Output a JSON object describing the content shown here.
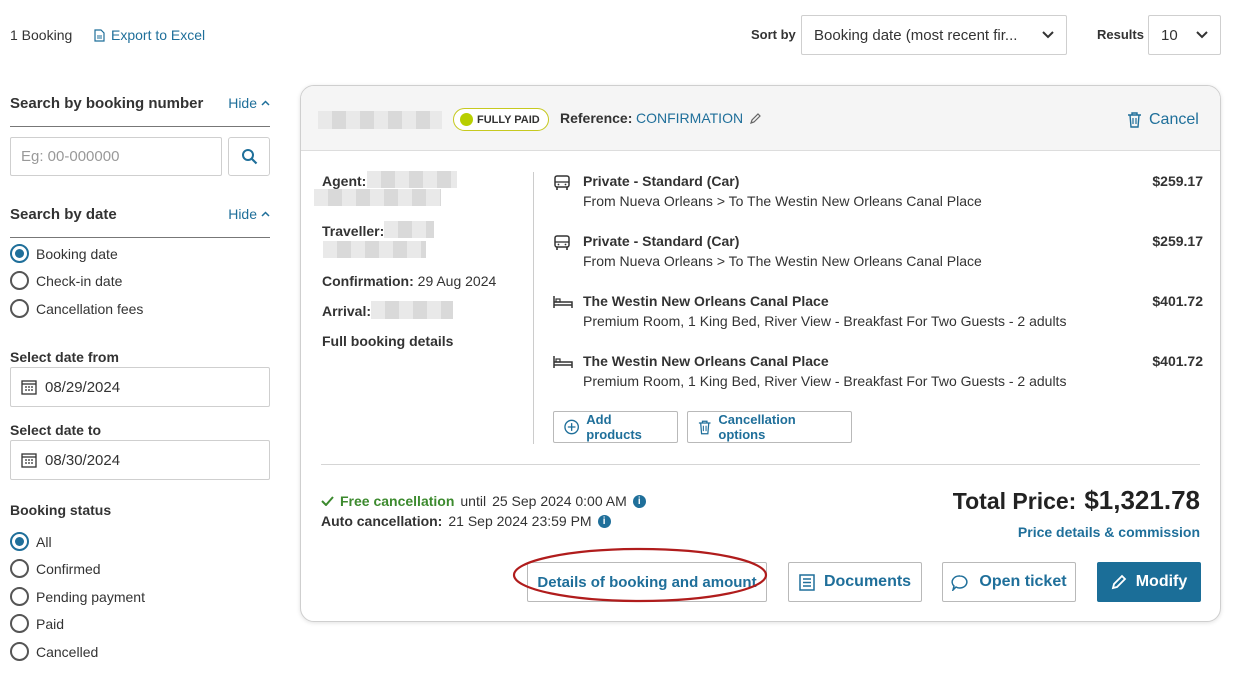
{
  "topbar": {
    "booking_count": "1 Booking",
    "export_label": "Export to Excel",
    "sort_label": "Sort by",
    "sort_value": "Booking date (most recent fir...",
    "results_label": "Results",
    "results_value": "10"
  },
  "sidebar": {
    "search_number": {
      "title": "Search by booking number",
      "hide": "Hide",
      "placeholder": "Eg: 00-000000"
    },
    "search_date": {
      "title": "Search by date",
      "hide": "Hide",
      "options": [
        {
          "label": "Booking date",
          "selected": true
        },
        {
          "label": "Check-in date",
          "selected": false
        },
        {
          "label": "Cancellation fees",
          "selected": false
        }
      ]
    },
    "date_from": {
      "label": "Select date from",
      "value": "08/29/2024"
    },
    "date_to": {
      "label": "Select date to",
      "value": "08/30/2024"
    },
    "status": {
      "title": "Booking status",
      "options": [
        {
          "label": "All",
          "selected": true
        },
        {
          "label": "Confirmed",
          "selected": false
        },
        {
          "label": "Pending payment",
          "selected": false
        },
        {
          "label": "Paid",
          "selected": false
        },
        {
          "label": "Cancelled",
          "selected": false
        }
      ]
    }
  },
  "booking": {
    "badge": "FULLY PAID",
    "reference_label": "Reference:",
    "reference_value": "CONFIRMATION",
    "cancel_label": "Cancel",
    "agent_label": "Agent:",
    "traveller_label": "Traveller:",
    "confirmation_label": "Confirmation:",
    "confirmation_value": "29 Aug 2024",
    "arrival_label": "Arrival:",
    "full_details": "Full booking details",
    "products": [
      {
        "type": "car-icon",
        "name": "Private - Standard (Car)",
        "desc": "From Nueva Orleans > To The Westin New Orleans Canal Place",
        "price": "$259.17"
      },
      {
        "type": "car-icon",
        "name": "Private - Standard (Car)",
        "desc": "From Nueva Orleans > To The Westin New Orleans Canal Place",
        "price": "$259.17"
      },
      {
        "type": "bed-icon",
        "name": "The Westin New Orleans Canal Place",
        "desc": "Premium Room, 1 King Bed, River View - Breakfast For Two Guests - 2 adults",
        "price": "$401.72"
      },
      {
        "type": "bed-icon",
        "name": "The Westin New Orleans Canal Place",
        "desc": "Premium Room, 1 King Bed, River View - Breakfast For Two Guests - 2 adults",
        "price": "$401.72"
      }
    ],
    "add_products": "Add products",
    "cancellation_options": "Cancellation options",
    "free_cancellation": "Free cancellation",
    "free_until": "until",
    "free_until_date": "25 Sep 2024 0:00 AM",
    "auto_cancellation_label": "Auto cancellation:",
    "auto_cancellation_date": "21 Sep 2024 23:59 PM",
    "total_label": "Total Price:",
    "total_value": "$1,321.78",
    "price_details": "Price details & commission",
    "details_btn": "Details of booking and amount",
    "documents_btn": "Documents",
    "open_ticket_btn": "Open ticket",
    "modify_btn": "Modify"
  },
  "colors": {
    "accent": "#1f6f9a",
    "modify_bg": "#1b6e98",
    "badge_dot": "#b8cf00",
    "highlight_ellipse": "#b01c1c",
    "free_green": "#3c8a2e"
  }
}
